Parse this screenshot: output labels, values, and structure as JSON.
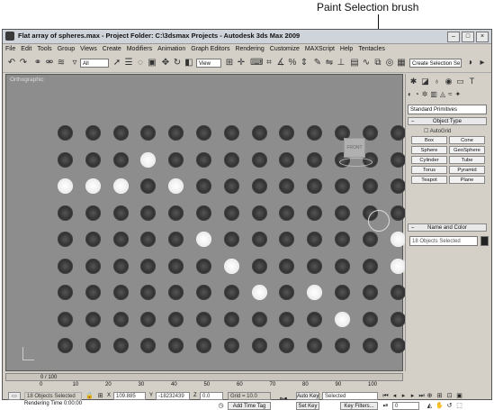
{
  "callout": "Paint Selection brush",
  "title": "Flat array of spheres.max    - Project Folder: C:\\3dsmax Projects    - Autodesk 3ds Max  2009",
  "window_buttons": [
    "–",
    "□",
    "×"
  ],
  "menu": [
    "File",
    "Edit",
    "Tools",
    "Group",
    "Views",
    "Create",
    "Modifiers",
    "Animation",
    "Graph Editors",
    "Rendering",
    "Customize",
    "MAXScript",
    "Help",
    "Tentacles"
  ],
  "toolbar": {
    "filter": "All",
    "coord": "View",
    "selection_set": "Create Selection Se",
    "icons": [
      "undo-icon",
      "redo-icon",
      "link-icon",
      "unlink-icon",
      "bind-space-warp-icon",
      "select-object-icon",
      "select-by-name-icon",
      "paint-selection-region-icon",
      "window-crossing-icon",
      "move-icon",
      "rotate-icon",
      "scale-icon",
      "pivot-icon",
      "select-manipulate-icon",
      "snap-icon",
      "angle-snap-icon",
      "percent-snap-icon",
      "mirror-icon",
      "align-icon",
      "render-setup-icon"
    ]
  },
  "viewport": {
    "label": "Orthographic",
    "viewcube_label": "FRONT",
    "selected": [
      [
        false,
        false,
        false,
        false,
        false,
        false,
        false,
        false,
        false,
        false,
        false,
        false,
        false,
        false
      ],
      [
        false,
        false,
        false,
        true,
        false,
        false,
        false,
        false,
        false,
        false,
        false,
        false,
        false,
        false
      ],
      [
        true,
        true,
        true,
        false,
        true,
        false,
        false,
        false,
        false,
        false,
        false,
        false,
        false,
        false
      ],
      [
        false,
        false,
        false,
        false,
        false,
        false,
        false,
        false,
        false,
        false,
        false,
        false,
        false,
        false
      ],
      [
        false,
        false,
        false,
        false,
        false,
        true,
        false,
        false,
        false,
        false,
        false,
        false,
        true,
        false
      ],
      [
        false,
        false,
        false,
        false,
        false,
        false,
        true,
        false,
        false,
        false,
        false,
        false,
        true,
        false
      ],
      [
        false,
        false,
        false,
        false,
        false,
        false,
        false,
        true,
        false,
        true,
        false,
        false,
        false,
        false
      ],
      [
        false,
        false,
        false,
        false,
        false,
        false,
        false,
        false,
        false,
        false,
        true,
        false,
        false,
        false
      ],
      [
        false,
        false,
        false,
        false,
        false,
        false,
        false,
        false,
        false,
        false,
        false,
        false,
        false,
        false
      ]
    ]
  },
  "command_panel": {
    "tabs": [
      "create-tab-icon",
      "modify-tab-icon",
      "hierarchy-tab-icon",
      "motion-tab-icon",
      "display-tab-icon",
      "utilities-tab-icon"
    ],
    "categories": [
      "geometry-icon",
      "shapes-icon",
      "lights-icon",
      "cameras-icon",
      "helpers-icon",
      "space-warps-icon",
      "systems-icon"
    ],
    "dropdown": "Standard Primitives",
    "object_type_title": "Object Type",
    "autogrid": "AutoGrid",
    "buttons": [
      "Box",
      "Cone",
      "Sphere",
      "GeoSphere",
      "Cylinder",
      "Tube",
      "Torus",
      "Pyramid",
      "Teapot",
      "Plane"
    ],
    "name_color_title": "Name and Color",
    "name_value": "18 Objects Selected"
  },
  "time_slider": {
    "label": "0 / 100"
  },
  "ruler_ticks": [
    "0",
    "10",
    "20",
    "30",
    "40",
    "50",
    "60",
    "70",
    "80",
    "90",
    "100"
  ],
  "status": {
    "selected": "18 Objects Selected",
    "render_time": "Rendering Time  0:00:00",
    "x_label": "X",
    "x_value": "109.885",
    "y_label": "Y",
    "y_value": "-18232439",
    "z_label": "Z",
    "z_value": "0.0",
    "grid": "Grid = 10.0",
    "add_time_tag": "Add Time Tag",
    "auto_key": "Auto Key",
    "set_key": "Set Key",
    "selected_dropdown": "Selected",
    "key_filters": "Key Filters...",
    "frame": "0"
  }
}
